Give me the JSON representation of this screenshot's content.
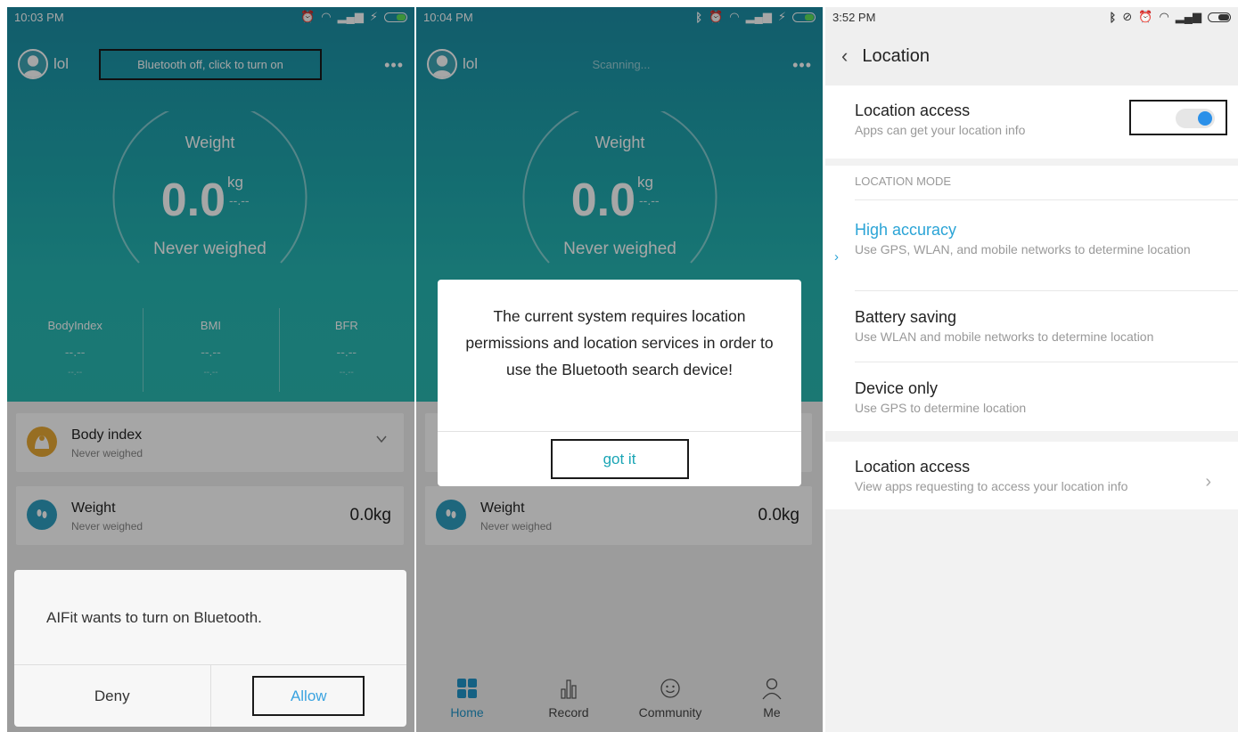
{
  "panel1": {
    "status": {
      "time": "10:03 PM"
    },
    "username": "lol",
    "bluetooth_banner": "Bluetooth off, click to turn on",
    "more": "•••",
    "gauge": {
      "label": "Weight",
      "value": "0.0",
      "unit": "kg",
      "sub": "--.--",
      "status": "Never weighed"
    },
    "metrics": [
      {
        "name": "BodyIndex",
        "value": "--.--",
        "sub": "--.--"
      },
      {
        "name": "BMI",
        "value": "--.--",
        "sub": "--.--"
      },
      {
        "name": "BFR",
        "value": "--.--",
        "sub": "--.--"
      }
    ],
    "cards": [
      {
        "title": "Body index",
        "sub": "Never weighed",
        "icon_color": "#e8a935"
      },
      {
        "title": "Weight",
        "sub": "Never weighed",
        "value": "0.0kg",
        "icon_color": "#2e9fc1"
      }
    ],
    "dialog": {
      "message": "AIFit wants to turn on Bluetooth.",
      "deny": "Deny",
      "allow": "Allow"
    }
  },
  "panel2": {
    "status": {
      "time": "10:04 PM"
    },
    "username": "lol",
    "scanning": "Scanning...",
    "more": "•••",
    "gauge": {
      "label": "Weight",
      "value": "0.0",
      "unit": "kg",
      "sub": "--.--",
      "status": "Never weighed"
    },
    "cards": [
      {
        "title": "Weight",
        "sub": "Never weighed",
        "value": "0.0kg",
        "icon_color": "#2e9fc1"
      }
    ],
    "dialog": {
      "message": "The current system requires location permissions and location services in order to use the Bluetooth search device!",
      "ok": "got it"
    },
    "nav": [
      {
        "label": "Home",
        "active": true
      },
      {
        "label": "Record"
      },
      {
        "label": "Community"
      },
      {
        "label": "Me"
      }
    ]
  },
  "panel3": {
    "status": {
      "time": "3:52 PM"
    },
    "title": "Location",
    "location_access": {
      "title": "Location access",
      "desc": "Apps can get your location info",
      "enabled": true
    },
    "mode_header": "LOCATION MODE",
    "modes": [
      {
        "title": "High accuracy",
        "desc": "Use GPS, WLAN, and mobile networks to determine location",
        "selected": true
      },
      {
        "title": "Battery saving",
        "desc": "Use WLAN and mobile networks to determine location"
      },
      {
        "title": "Device only",
        "desc": "Use GPS to determine location"
      }
    ],
    "requests": {
      "title": "Location access",
      "desc": "View apps requesting to access your location info"
    }
  },
  "colors": {
    "teal": "#26b7b3",
    "accent_blue": "#2ba4d6",
    "toggle_blue": "#2b90e9"
  }
}
